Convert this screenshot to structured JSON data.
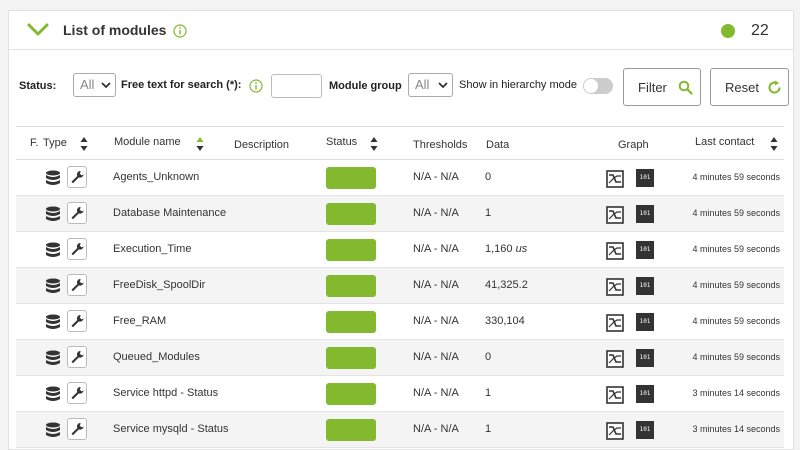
{
  "header": {
    "title": "List of modules",
    "count": "22",
    "status_color": "#82b92e"
  },
  "filters": {
    "status_label": "Status:",
    "status_value": "All",
    "search_label": "Free text for search (*):",
    "search_value": "",
    "group_label": "Module group",
    "group_value": "All",
    "hierarchy_label": "Show in hierarchy mode",
    "filter_button": "Filter",
    "reset_button": "Reset"
  },
  "columns": {
    "f": "F.",
    "type": "Type",
    "module_name": "Module name",
    "description": "Description",
    "status": "Status",
    "thresholds": "Thresholds",
    "data": "Data",
    "graph": "Graph",
    "last_contact": "Last contact"
  },
  "rows": [
    {
      "name": "Agents_Unknown",
      "thresholds": "N/A - N/A",
      "data": "0",
      "unit": "",
      "last_contact": "4 minutes 59 seconds"
    },
    {
      "name": "Database Maintenance",
      "thresholds": "N/A - N/A",
      "data": "1",
      "unit": "",
      "last_contact": "4 minutes 59 seconds"
    },
    {
      "name": "Execution_Time",
      "thresholds": "N/A - N/A",
      "data": "1,160",
      "unit": "us",
      "last_contact": "4 minutes 59 seconds"
    },
    {
      "name": "FreeDisk_SpoolDir",
      "thresholds": "N/A - N/A",
      "data": "41,325.2",
      "unit": "",
      "last_contact": "4 minutes 59 seconds"
    },
    {
      "name": "Free_RAM",
      "thresholds": "N/A - N/A",
      "data": "330,104",
      "unit": "",
      "last_contact": "4 minutes 59 seconds"
    },
    {
      "name": "Queued_Modules",
      "thresholds": "N/A - N/A",
      "data": "0",
      "unit": "",
      "last_contact": "4 minutes 59 seconds"
    },
    {
      "name": "Service httpd - Status",
      "thresholds": "N/A - N/A",
      "data": "1",
      "unit": "",
      "last_contact": "3 minutes 14 seconds"
    },
    {
      "name": "Service mysqld - Status",
      "thresholds": "N/A - N/A",
      "data": "1",
      "unit": "",
      "last_contact": "3 minutes 14 seconds"
    }
  ],
  "icons": {
    "collapse": "chevron-down-icon",
    "info": "info-icon",
    "search": "search-icon",
    "reset": "refresh-icon",
    "type": "database-icon",
    "config": "wrench-icon",
    "graph": "graph-icon",
    "raw_data": "binary-data-icon"
  }
}
